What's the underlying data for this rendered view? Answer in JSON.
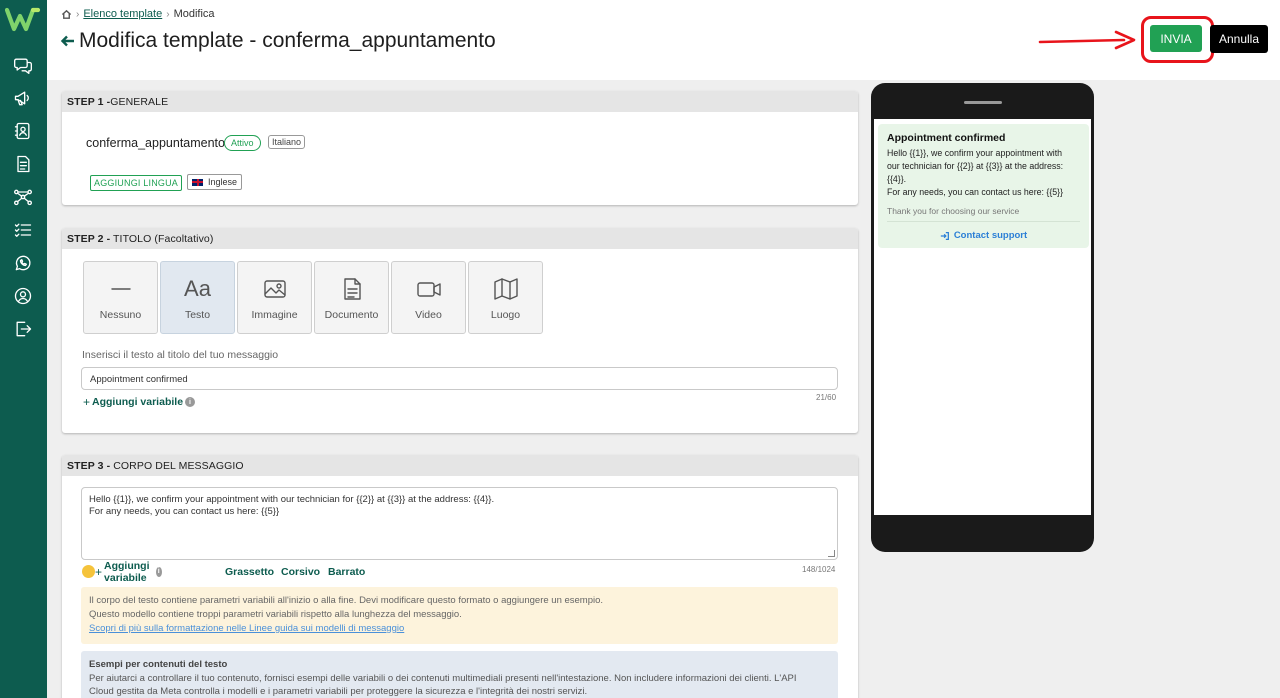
{
  "breadcrumb": {
    "link": "Elenco template",
    "current": "Modifica"
  },
  "page": {
    "title": "Modifica template - conferma_appuntamento"
  },
  "actions": {
    "send_label": "INVIA",
    "cancel_label": "Annulla"
  },
  "colors": {
    "sidebar": "#0d5c4f",
    "send_button": "#21a154",
    "cancel_button": "#000000",
    "annotation_red": "#e8141b",
    "bubble_bg": "#e8f5e8"
  },
  "sidebar": {
    "items": [
      {
        "icon": "chat-icon"
      },
      {
        "icon": "megaphone-icon"
      },
      {
        "icon": "contacts-icon"
      },
      {
        "icon": "document-icon"
      },
      {
        "icon": "flow-icon"
      },
      {
        "icon": "checklist-icon"
      },
      {
        "icon": "whatsapp-icon"
      },
      {
        "icon": "user-icon"
      },
      {
        "icon": "logout-icon"
      }
    ]
  },
  "step1": {
    "heading_bold": "STEP 1 -",
    "heading_rest": "GENERALE",
    "template_name": "conferma_appuntamento",
    "status_badge": "Attivo",
    "language_badge": "Italiano",
    "add_language_button": "AGGIUNGI LINGUA",
    "language_chip": "Inglese"
  },
  "step2": {
    "heading_bold": "STEP 2 -",
    "heading_rest": " TITOLO (Facoltativo)",
    "types": [
      {
        "label": "Nessuno",
        "icon": "dash-icon",
        "selected": false
      },
      {
        "label": "Testo",
        "icon": "text-aa-icon",
        "selected": true
      },
      {
        "label": "Immagine",
        "icon": "image-icon",
        "selected": false
      },
      {
        "label": "Documento",
        "icon": "document-icon",
        "selected": false
      },
      {
        "label": "Video",
        "icon": "video-icon",
        "selected": false
      },
      {
        "label": "Luogo",
        "icon": "map-icon",
        "selected": false
      }
    ],
    "title_label": "Inserisci il testo al titolo del tuo messaggio",
    "title_value": "Appointment confirmed",
    "add_variable": "Aggiungi variabile",
    "counter": "21/60"
  },
  "step3": {
    "heading_bold": "STEP 3 -",
    "heading_rest": " CORPO DEL MESSAGGIO",
    "body_line1": "Hello {{1}}, we confirm your appointment with our technician for {{2}} at {{3}} at the address: {{4}}.",
    "body_line2": "For any needs, you can contact us here: {{5}}",
    "add_variable": "Aggiungi variabile",
    "bold": "Grassetto",
    "italic": "Corsivo",
    "strike": "Barrato",
    "counter": "148/1024",
    "warning_line1": "Il corpo del testo contiene parametri variabili all'inizio o alla fine. Devi modificare questo formato o aggiungere un esempio.",
    "warning_line2": "Questo modello contiene troppi parametri variabili rispetto alla lunghezza del messaggio.",
    "warning_link": "Scopri di più sulla formattazione nelle Linee guida sui modelli di messaggio",
    "example_heading": "Esempi per contenuti del testo",
    "example_line1": "Per aiutarci a controllare il tuo contenuto, fornisci esempi delle variabili o dei contenuti multimediali presenti nell'intestazione. Non includere informazioni dei clienti. L'API",
    "example_line2": "Cloud gestita da Meta controlla i modelli e i parametri variabili per proteggere la sicurezza e l'integrità dei nostri servizi."
  },
  "preview": {
    "title": "Appointment confirmed",
    "body_line1": "Hello {{1}}, we confirm your appointment with",
    "body_line2": "our technician for {{2}} at {{3}} at the address:",
    "body_line3": "{{4}}.",
    "body_line4": "For any needs, you can contact us here: {{5}}",
    "footer": "Thank you for choosing our service",
    "button": "Contact support"
  }
}
